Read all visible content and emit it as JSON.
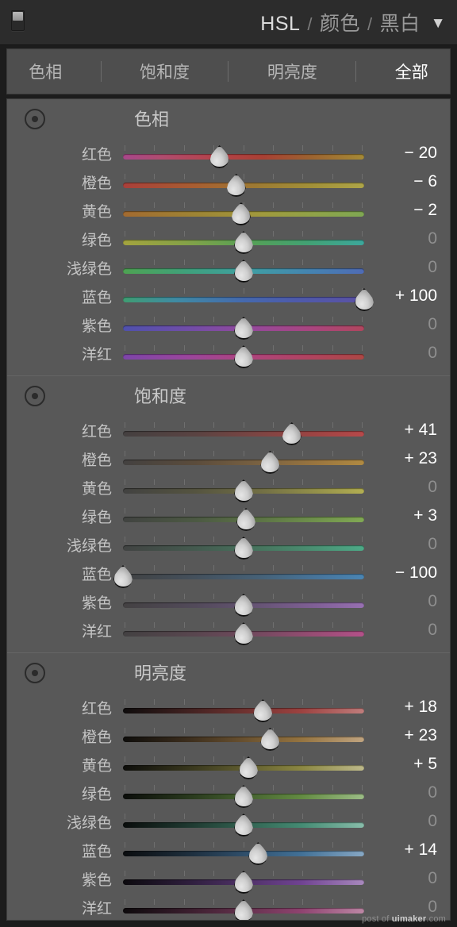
{
  "header": {
    "enable_switch_name": "panel-toggle",
    "title_main": "HSL",
    "sep1": "/",
    "title_color": "颜色",
    "sep2": "/",
    "title_bw": "黑白",
    "caret": "▼"
  },
  "tabs": [
    {
      "label": "色相",
      "active": false
    },
    {
      "label": "饱和度",
      "active": false
    },
    {
      "label": "明亮度",
      "active": false
    },
    {
      "label": "全部",
      "active": true
    }
  ],
  "colors": {
    "panel_bg": "#585858",
    "header_bg": "#2c2c2c",
    "tabbar_bg": "#4e4e4e",
    "outer_border": "#1c1c1c",
    "value_active": "#ffffff",
    "value_zero": "#8f8f8f"
  },
  "groups": [
    {
      "title": "色相",
      "target_tool": "target-adjust-icon",
      "rows": [
        {
          "label": "红色",
          "value": "− 20",
          "num": -20,
          "pos": 40,
          "track": "linear-gradient(90deg,#a8478a 0%,#b04c6f 16%,#b5424a 38%,#a94034 58%,#9c6330 78%,#a58a36 100%)"
        },
        {
          "label": "橙色",
          "value": "− 6",
          "num": -6,
          "pos": 47,
          "track": "linear-gradient(90deg,#a93f3a 0%,#a85c32 28%,#9d7a33 55%,#a29038 78%,#aea548 100%)"
        },
        {
          "label": "黄色",
          "value": "− 2",
          "num": -2,
          "pos": 49,
          "track": "linear-gradient(90deg,#a26a30 0%,#9e8434 30%,#a09a3d 58%,#8fa349 80%,#7fa753 100%)"
        },
        {
          "label": "绿色",
          "value": "0",
          "num": 0,
          "pos": 50,
          "track": "linear-gradient(90deg,#a3a33e 0%,#85a248 26%,#56a055 52%,#43a173 76%,#3da79c 100%)"
        },
        {
          "label": "浅绿色",
          "value": "0",
          "num": 0,
          "pos": 50,
          "track": "linear-gradient(90deg,#4ea252 0%,#3fa17e 28%,#3f9fa3 52%,#4583b1 78%,#4f6bb5 100%)"
        },
        {
          "label": "蓝色",
          "value": "+ 100",
          "num": 100,
          "pos": 100,
          "track": "linear-gradient(90deg,#3f9d72 0%,#3f8ba4 22%,#4569ae 50%,#4e5aab 72%,#5b51a4 100%)"
        },
        {
          "label": "紫色",
          "value": "0",
          "num": 0,
          "pos": 50,
          "track": "linear-gradient(90deg,#4f51ac 0%,#6f4da8 26%,#93499c 52%,#a9457f 78%,#b0465e 100%)"
        },
        {
          "label": "洋红",
          "value": "0",
          "num": 0,
          "pos": 50,
          "track": "linear-gradient(90deg,#7d45a9 0%,#9a469d 26%,#ae4480 50%,#b04361 76%,#ad4744 100%)"
        }
      ]
    },
    {
      "title": "饱和度",
      "target_tool": "target-adjust-icon",
      "rows": [
        {
          "label": "红色",
          "value": "+ 41",
          "num": 41,
          "pos": 70,
          "track": "linear-gradient(90deg,#444040 0%,#5a4342 30%,#7b4543 55%,#9c4443 78%,#b7494a 100%)"
        },
        {
          "label": "橙色",
          "value": "+ 23",
          "num": 23,
          "pos": 61,
          "track": "linear-gradient(90deg,#434140 0%,#5b4c3c 30%,#7b6342 58%,#99753f 80%,#b08a42 100%)"
        },
        {
          "label": "黄色",
          "value": "0",
          "num": 0,
          "pos": 50,
          "track": "linear-gradient(90deg,#424241 0%,#555440 30%,#737045 58%,#93904a 80%,#b2ae52 100%)"
        },
        {
          "label": "绿色",
          "value": "+ 3",
          "num": 3,
          "pos": 51,
          "track": "linear-gradient(90deg,#414341 0%,#4c5943 30%,#5d7546 58%,#6f914c 80%,#81a954 100%)"
        },
        {
          "label": "浅绿色",
          "value": "0",
          "num": 0,
          "pos": 50,
          "track": "linear-gradient(90deg,#414342 0%,#445a4f 30%,#47765f 58%,#4a9173 80%,#4daa87 100%)"
        },
        {
          "label": "蓝色",
          "value": "− 100",
          "num": -100,
          "pos": 0,
          "track": "linear-gradient(90deg,#414243 0%,#44505c 30%,#466278 58%,#47749a 80%,#4a85b3 100%)"
        },
        {
          "label": "紫色",
          "value": "0",
          "num": 0,
          "pos": 50,
          "track": "linear-gradient(90deg,#434142 0%,#524a5a 30%,#685577 58%,#806096 80%,#9770b2 100%)"
        },
        {
          "label": "洋红",
          "value": "0",
          "num": 0,
          "pos": 50,
          "track": "linear-gradient(90deg,#434142 0%,#59464f 30%,#774a61 58%,#994d75 80%,#b35189 100%)"
        }
      ]
    },
    {
      "title": "明亮度",
      "target_tool": "target-adjust-icon",
      "rows": [
        {
          "label": "红色",
          "value": "+ 18",
          "num": 18,
          "pos": 58,
          "track": "linear-gradient(90deg,#0e0c0c 0%,#3f2120 26%,#6e3230 50%,#9d4240 74%,#c07d7c 100%)"
        },
        {
          "label": "橙色",
          "value": "+ 23",
          "num": 23,
          "pos": 61,
          "track": "linear-gradient(90deg,#0e0d0b 0%,#3a2c1c 26%,#68502f 50%,#957440 74%,#c0a480 100%)"
        },
        {
          "label": "黄色",
          "value": "+ 5",
          "num": 5,
          "pos": 52,
          "track": "linear-gradient(90deg,#0d0d0a 0%,#35341c 26%,#5f5c2f 50%,#8b8742 74%,#bdb98a 100%)"
        },
        {
          "label": "绿色",
          "value": "0",
          "num": 0,
          "pos": 50,
          "track": "linear-gradient(90deg,#0b0d0a 0%,#27361c 26%,#44602f 50%,#638b42 74%,#9cbd86 100%)"
        },
        {
          "label": "浅绿色",
          "value": "0",
          "num": 0,
          "pos": 50,
          "track": "linear-gradient(90deg,#0a0d0c 0%,#1d362e 26%,#31604f 50%,#448b73 74%,#88bdaa 100%)"
        },
        {
          "label": "蓝色",
          "value": "+ 14",
          "num": 14,
          "pos": 56,
          "track": "linear-gradient(90deg,#0a0c0e 0%,#1c2c3a 26%,#2f4e6a 50%,#427197 74%,#87a8c5 100%)"
        },
        {
          "label": "紫色",
          "value": "0",
          "num": 0,
          "pos": 50,
          "track": "linear-gradient(90deg,#0c0a0e 0%,#2c1d3a 26%,#4e3166 50%,#704392 74%,#a889bd 100%)"
        },
        {
          "label": "洋红",
          "value": "0",
          "num": 0,
          "pos": 50,
          "track": "linear-gradient(90deg,#0d0a0c 0%,#381d2c 26%,#63314c 50%,#8f4370 74%,#bd87a5 100%)"
        }
      ]
    }
  ],
  "watermark": {
    "prefix": "post of ",
    "brand": "uimaker",
    "suffix": ".com"
  }
}
